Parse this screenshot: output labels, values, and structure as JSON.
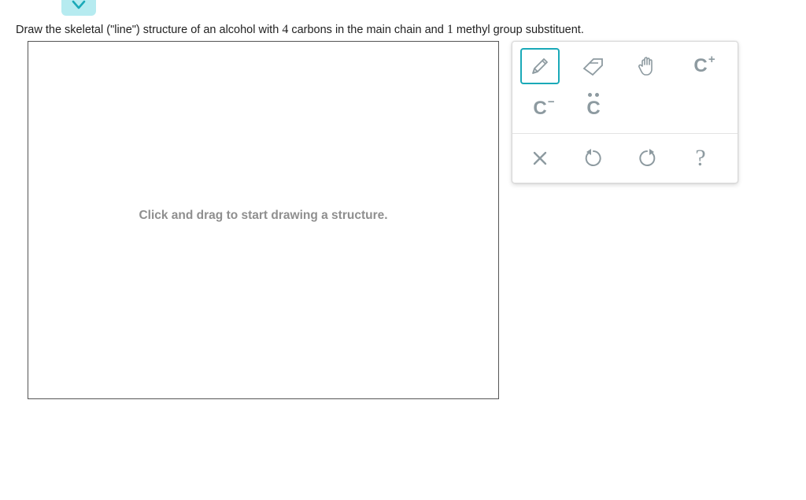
{
  "question": {
    "prefix": "Draw the skeletal (\"line\") structure of an alcohol with ",
    "num1": "4",
    "mid": " carbons in the main chain and ",
    "num2": "1",
    "suffix": " methyl group substituent."
  },
  "canvas": {
    "placeholder": "Click and drag to start drawing a structure."
  },
  "tools": {
    "draw": "Draw",
    "erase": "Erase",
    "move": "Move",
    "cplus": "C",
    "cminus": "C",
    "cradical": "C",
    "clear": "Clear",
    "undo": "Undo",
    "redo": "Redo",
    "help": "?"
  }
}
